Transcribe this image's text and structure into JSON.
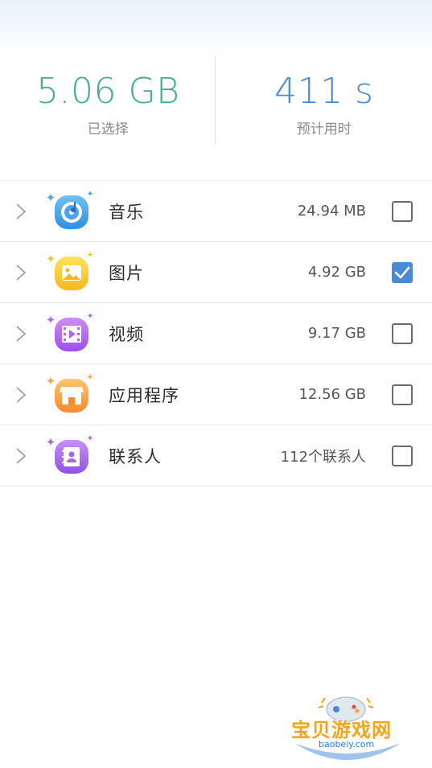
{
  "summary": {
    "selected_value": "5.06 GB",
    "selected_label": "已选择",
    "time_value": "411 s",
    "time_label": "预计用时"
  },
  "items": [
    {
      "label": "音乐",
      "value": "24.94 MB",
      "checked": false,
      "icon": "music-disc-icon"
    },
    {
      "label": "图片",
      "value": "4.92 GB",
      "checked": true,
      "icon": "picture-icon"
    },
    {
      "label": "视频",
      "value": "9.17 GB",
      "checked": false,
      "icon": "video-icon"
    },
    {
      "label": "应用程序",
      "value": "12.56 GB",
      "checked": false,
      "icon": "app-store-icon"
    },
    {
      "label": "联系人",
      "value": "112个联系人",
      "checked": false,
      "icon": "contacts-icon"
    }
  ],
  "watermark": {
    "text": "宝贝游戏网",
    "url": "baobeiy.com"
  },
  "colors": {
    "accent_green": "#3fae8e",
    "accent_blue": "#4a8ad4"
  }
}
